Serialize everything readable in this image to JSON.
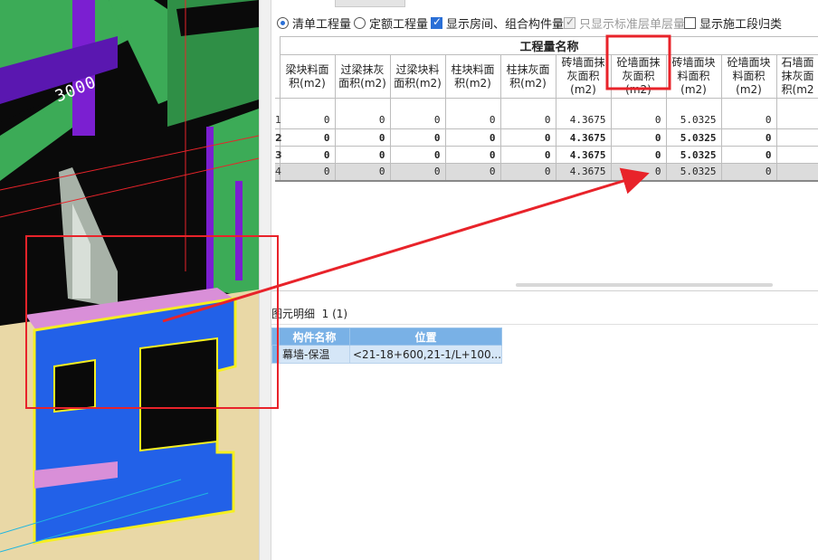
{
  "viewport": {
    "dimension_label": "3000",
    "colors": {
      "background": "#0a0a0a",
      "wall_green": "#3cab57",
      "wall_green_dark": "#2c7a3e",
      "column_purple": "#7b1fd1",
      "highlight_blue": "#2261e8",
      "insulation_beige": "#e9d8a6",
      "pink_trim": "#d98fd8",
      "selection_yellow": "#f5ef20",
      "annotation_red": "#e8232a"
    }
  },
  "options": {
    "list_quantity": "清单工程量",
    "quota_quantity": "定额工程量",
    "show_rooms": "显示房间、组合构件量",
    "standard_floor_only": "只显示标准层单层量",
    "show_construction_segment": "显示施工段归类",
    "list_quantity_selected": true,
    "show_rooms_checked": true,
    "standard_floor_only_checked": true,
    "standard_floor_only_disabled": true,
    "show_construction_segment_checked": false
  },
  "quantity_table": {
    "group_header": "工程量名称",
    "columns": [
      "梁块料面积(m2)",
      "过梁抹灰面积(m2)",
      "过梁块料面积(m2)",
      "柱块料面积(m2)",
      "柱抹灰面积(m2)",
      "砖墙面抹灰面积(m2)",
      "砼墙面抹灰面积(m2)",
      "砖墙面块料面积(m2)",
      "砼墙面块料面积(m2)",
      "石墙面抹灰面积(m2"
    ],
    "rows": [
      {
        "num": "1",
        "cells": [
          "0",
          "0",
          "0",
          "0",
          "0",
          "4.3675",
          "0",
          "5.0325",
          "0",
          ""
        ]
      },
      {
        "num": "2",
        "cells": [
          "0",
          "0",
          "0",
          "0",
          "0",
          "4.3675",
          "0",
          "5.0325",
          "0",
          ""
        ]
      },
      {
        "num": "3",
        "cells": [
          "0",
          "0",
          "0",
          "0",
          "0",
          "4.3675",
          "0",
          "5.0325",
          "0",
          ""
        ]
      },
      {
        "num": "4",
        "cells": [
          "0",
          "0",
          "0",
          "0",
          "0",
          "4.3675",
          "0",
          "5.0325",
          "0",
          ""
        ]
      }
    ]
  },
  "detail": {
    "title": "图元明细",
    "count": "1 (1)",
    "headers": [
      "构件名称",
      "位置"
    ],
    "rows": [
      {
        "name": "幕墙-保温",
        "position": "<21-18+600,21-1/L+100..."
      }
    ]
  }
}
